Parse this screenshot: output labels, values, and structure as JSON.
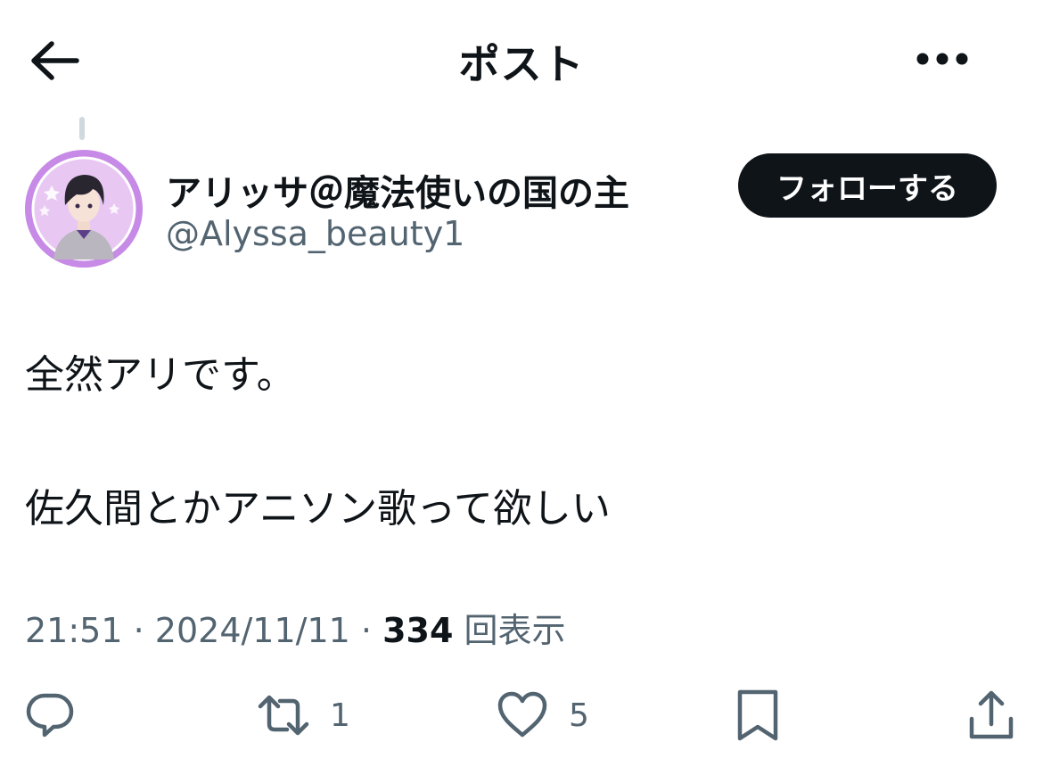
{
  "header": {
    "title": "ポスト",
    "back_icon": "arrow-left-icon",
    "more_icon": "more-dots-icon"
  },
  "author": {
    "display_name": "アリッサ＠魔法使いの国の主",
    "handle": "@Alyssa_beauty1",
    "avatar_label": "Alyssa",
    "follow_label": "フォローする"
  },
  "tweet": {
    "line1": "全然アリです。",
    "line2": "佐久間とかアニソン歌って欲しい",
    "time": "21:51",
    "date": "2024/11/11",
    "views_count": "334",
    "views_label": "回表示",
    "separator": "·"
  },
  "actions": {
    "reply_count": "",
    "retweet_count": "1",
    "like_count": "5"
  },
  "colors": {
    "text": "#0f1419",
    "secondary": "#536471",
    "follow_bg": "#0f1419",
    "avatar_ring": "#c78ae6"
  }
}
